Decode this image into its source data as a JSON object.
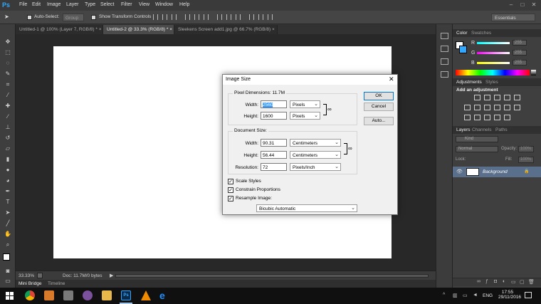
{
  "app": {
    "logo": "Ps"
  },
  "menubar": {
    "items": [
      "File",
      "Edit",
      "Image",
      "Layer",
      "Type",
      "Select",
      "Filter",
      "View",
      "Window",
      "Help"
    ],
    "controls": [
      "–",
      "□",
      "✕"
    ]
  },
  "optionsbar": {
    "auto_select_label": "Auto-Select:",
    "auto_select_value": "Group",
    "show_transform_label": "Show Transform Controls",
    "workspace": "Essentials"
  },
  "doc_tabs": [
    {
      "label": "Untitled-1 @ 100% (Layer 7, RGB/8) *",
      "close": "×"
    },
    {
      "label": "Untitled-2 @ 33.3% (RGB/8) *",
      "close": "×"
    },
    {
      "label": "Sleekens  Screen add1.jpg @ 66.7% (RGB/8)",
      "close": "×"
    }
  ],
  "statusbar": {
    "zoom": "33.33%",
    "doc_info": "Doc: 11.7M/0 bytes"
  },
  "bottom_tabs": [
    "Mini Bridge",
    "Timeline"
  ],
  "color_panel": {
    "tabs": [
      "Color",
      "Swatches"
    ],
    "channels": [
      {
        "label": "R",
        "value": "255"
      },
      {
        "label": "G",
        "value": "255"
      },
      {
        "label": "B",
        "value": "255"
      }
    ]
  },
  "adjustments_panel": {
    "tabs": [
      "Adjustments",
      "Styles"
    ],
    "heading": "Add an adjustment"
  },
  "layers_panel": {
    "tabs": [
      "Layers",
      "Channels",
      "Paths"
    ],
    "kind_label": "Kind",
    "blend_mode": "Normal",
    "opacity_label": "Opacity:",
    "opacity_value": "100%",
    "lock_label": "Lock:",
    "fill_label": "Fill:",
    "fill_value": "100%",
    "layer_name": "Background"
  },
  "dialog": {
    "title": "Image Size",
    "close": "✕",
    "pixel_dimensions_title": "Pixel Dimensions:  11.7M",
    "width_label": "Width:",
    "width_value": "2560",
    "width_unit": "Pixels",
    "height_label": "Height:",
    "height_value": "1600",
    "height_unit": "Pixels",
    "document_size_title": "Document Size:",
    "doc_width_label": "Width:",
    "doc_width_value": "90.31",
    "doc_width_unit": "Centimeters",
    "doc_height_label": "Height:",
    "doc_height_value": "56.44",
    "doc_height_unit": "Centimeters",
    "resolution_label": "Resolution:",
    "resolution_value": "72",
    "resolution_unit": "Pixels/Inch",
    "scale_styles_label": "Scale Styles",
    "constrain_label": "Constrain Proportions",
    "resample_label": "Resample Image:",
    "resample_method": "Bicubic Automatic",
    "ok_label": "OK",
    "cancel_label": "Cancel",
    "auto_label": "Auto...",
    "checkmark": "✓",
    "dropdown_arrow": "⌄"
  },
  "taskbar": {
    "language": "ENG",
    "time": "17:55",
    "date": "29/11/2016"
  },
  "colors": {
    "photoshop_blue": "#31a8ff",
    "dialog_bg": "#f0f0f0",
    "selection": "#3399ff"
  }
}
